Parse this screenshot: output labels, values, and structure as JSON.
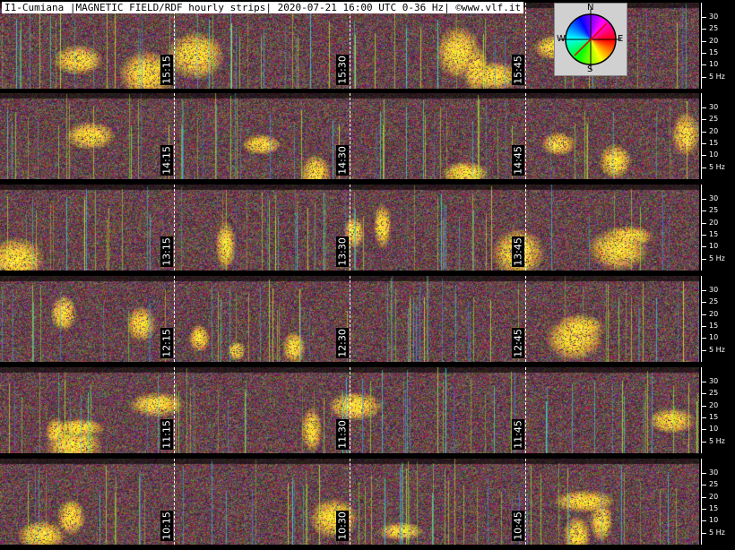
{
  "title": "I1-Cumiana |MAGNETIC FIELD/RDF hourly strips| 2020-07-21 16:00 UTC 0-36 Hz| ©www.vlf.it",
  "compass": {
    "n": "N",
    "s": "S",
    "e": "E",
    "w": "W"
  },
  "scale": {
    "ticks": [
      "30",
      "25",
      "20",
      "15",
      "10",
      "5 Hz"
    ],
    "values": [
      30,
      25,
      20,
      15,
      10,
      5
    ],
    "max_hz": 36
  },
  "strips": [
    {
      "labels": [
        "15:15",
        "15:30",
        "15:45"
      ]
    },
    {
      "labels": [
        "14:15",
        "14:30",
        "14:45"
      ]
    },
    {
      "labels": [
        "13:15",
        "13:30",
        "13:45"
      ]
    },
    {
      "labels": [
        "12:15",
        "12:30",
        "12:45"
      ]
    },
    {
      "labels": [
        "11:15",
        "11:30",
        "11:45"
      ]
    },
    {
      "labels": [
        "10:15",
        "10:30",
        "10:45"
      ]
    }
  ]
}
